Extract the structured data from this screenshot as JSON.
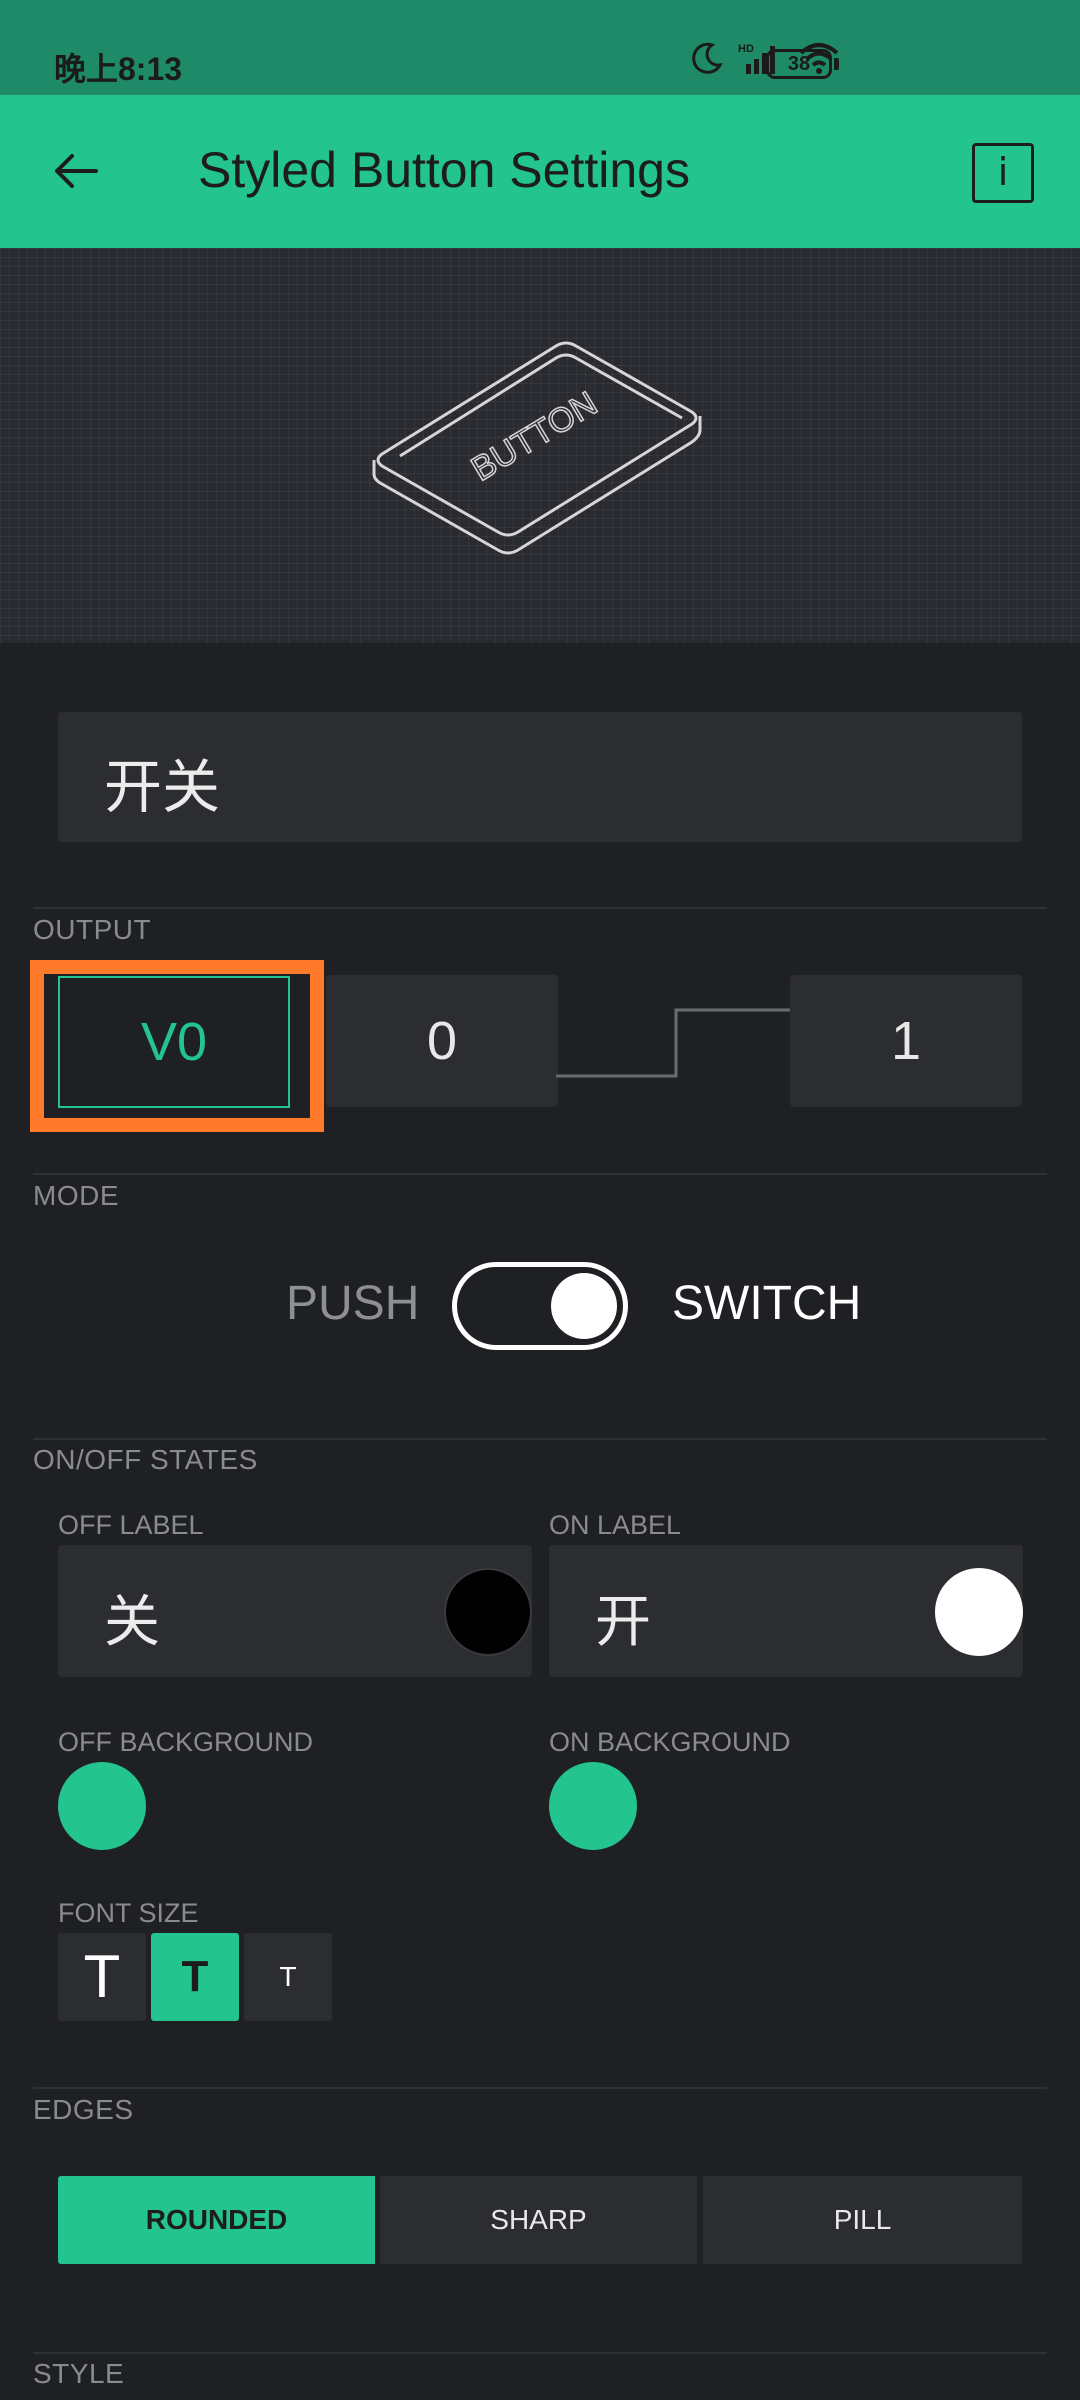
{
  "status_bar": {
    "time": "晚上8:13",
    "network": "HD",
    "battery": "38"
  },
  "app_bar": {
    "title": "Styled Button Settings",
    "info": "i"
  },
  "hero": {
    "illustration_label": "BUTTON"
  },
  "name_field": {
    "value": "开关"
  },
  "output": {
    "section_label": "OUTPUT",
    "pin": "V0",
    "off_value": "0",
    "on_value": "1"
  },
  "mode": {
    "section_label": "MODE",
    "push_label": "PUSH",
    "switch_label": "SWITCH",
    "selected": "SWITCH"
  },
  "states": {
    "section_label": "ON/OFF STATES",
    "off_label_title": "OFF LABEL",
    "off_label_value": "关",
    "off_label_color": "#000000",
    "on_label_title": "ON LABEL",
    "on_label_value": "开",
    "on_label_color": "#ffffff",
    "off_background_title": "OFF BACKGROUND",
    "off_background_color": "#23c48e",
    "on_background_title": "ON BACKGROUND",
    "on_background_color": "#23c48e"
  },
  "font_size": {
    "title": "FONT SIZE",
    "options": [
      "T",
      "T",
      "T"
    ],
    "selected_index": 1
  },
  "edges": {
    "section_label": "EDGES",
    "options": [
      "ROUNDED",
      "SHARP",
      "PILL"
    ],
    "selected": "ROUNDED"
  },
  "style": {
    "section_label": "STYLE"
  },
  "colors": {
    "accent": "#23c48e",
    "status_bar": "#1e8a68",
    "background": "#1f2024",
    "highlight": "#ff7a2a"
  }
}
